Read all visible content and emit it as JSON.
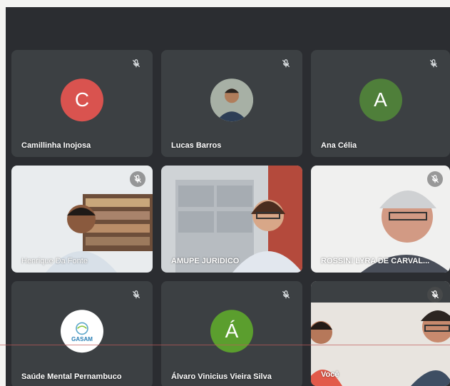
{
  "participants": [
    {
      "name": "Camillinha Inojosa",
      "initial": "C",
      "color": "#d9534f"
    },
    {
      "name": "Lucas Barros",
      "initial": "",
      "color": "#6e7b6f"
    },
    {
      "name": "Ana Célia",
      "initial": "A",
      "color": "#4f7f3a"
    },
    {
      "name": "Henrique Da Fonte",
      "initial": "",
      "color": ""
    },
    {
      "name": "AMUPE JURIDICO",
      "initial": "",
      "color": ""
    },
    {
      "name": "ROSSINI LYRA DE CARVAL...",
      "initial": "",
      "color": ""
    },
    {
      "name": "Saúde Mental Pernambuco",
      "initial": "",
      "logo_text": "GASAM",
      "color": "#ffffff"
    },
    {
      "name": "Álvaro Vinicius Vieira Silva",
      "initial": "Á",
      "color": "#5b9e2e"
    },
    {
      "name": "Você",
      "initial": "",
      "color": ""
    }
  ]
}
